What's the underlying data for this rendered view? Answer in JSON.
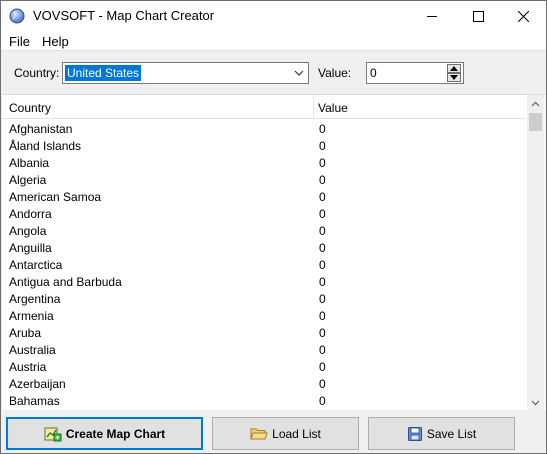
{
  "window": {
    "title": "VOVSOFT - Map Chart Creator"
  },
  "menu": {
    "file": "File",
    "help": "Help"
  },
  "form": {
    "country_label": "Country:",
    "country_value": "United States",
    "value_label": "Value:",
    "value_value": "0"
  },
  "list": {
    "col_country": "Country",
    "col_value": "Value",
    "rows": [
      {
        "country": "Afghanistan",
        "value": "0"
      },
      {
        "country": "Åland Islands",
        "value": "0"
      },
      {
        "country": "Albania",
        "value": "0"
      },
      {
        "country": "Algeria",
        "value": "0"
      },
      {
        "country": "American Samoa",
        "value": "0"
      },
      {
        "country": "Andorra",
        "value": "0"
      },
      {
        "country": "Angola",
        "value": "0"
      },
      {
        "country": "Anguilla",
        "value": "0"
      },
      {
        "country": "Antarctica",
        "value": "0"
      },
      {
        "country": "Antigua and Barbuda",
        "value": "0"
      },
      {
        "country": "Argentina",
        "value": "0"
      },
      {
        "country": "Armenia",
        "value": "0"
      },
      {
        "country": "Aruba",
        "value": "0"
      },
      {
        "country": "Australia",
        "value": "0"
      },
      {
        "country": "Austria",
        "value": "0"
      },
      {
        "country": "Azerbaijan",
        "value": "0"
      },
      {
        "country": "Bahamas",
        "value": "0"
      }
    ]
  },
  "buttons": {
    "create": "Create Map Chart",
    "load": "Load List",
    "save": "Save List"
  },
  "colors": {
    "accent": "#0078d7",
    "window_bg": "#f0f0f0",
    "button_bg": "#e1e1e1"
  }
}
